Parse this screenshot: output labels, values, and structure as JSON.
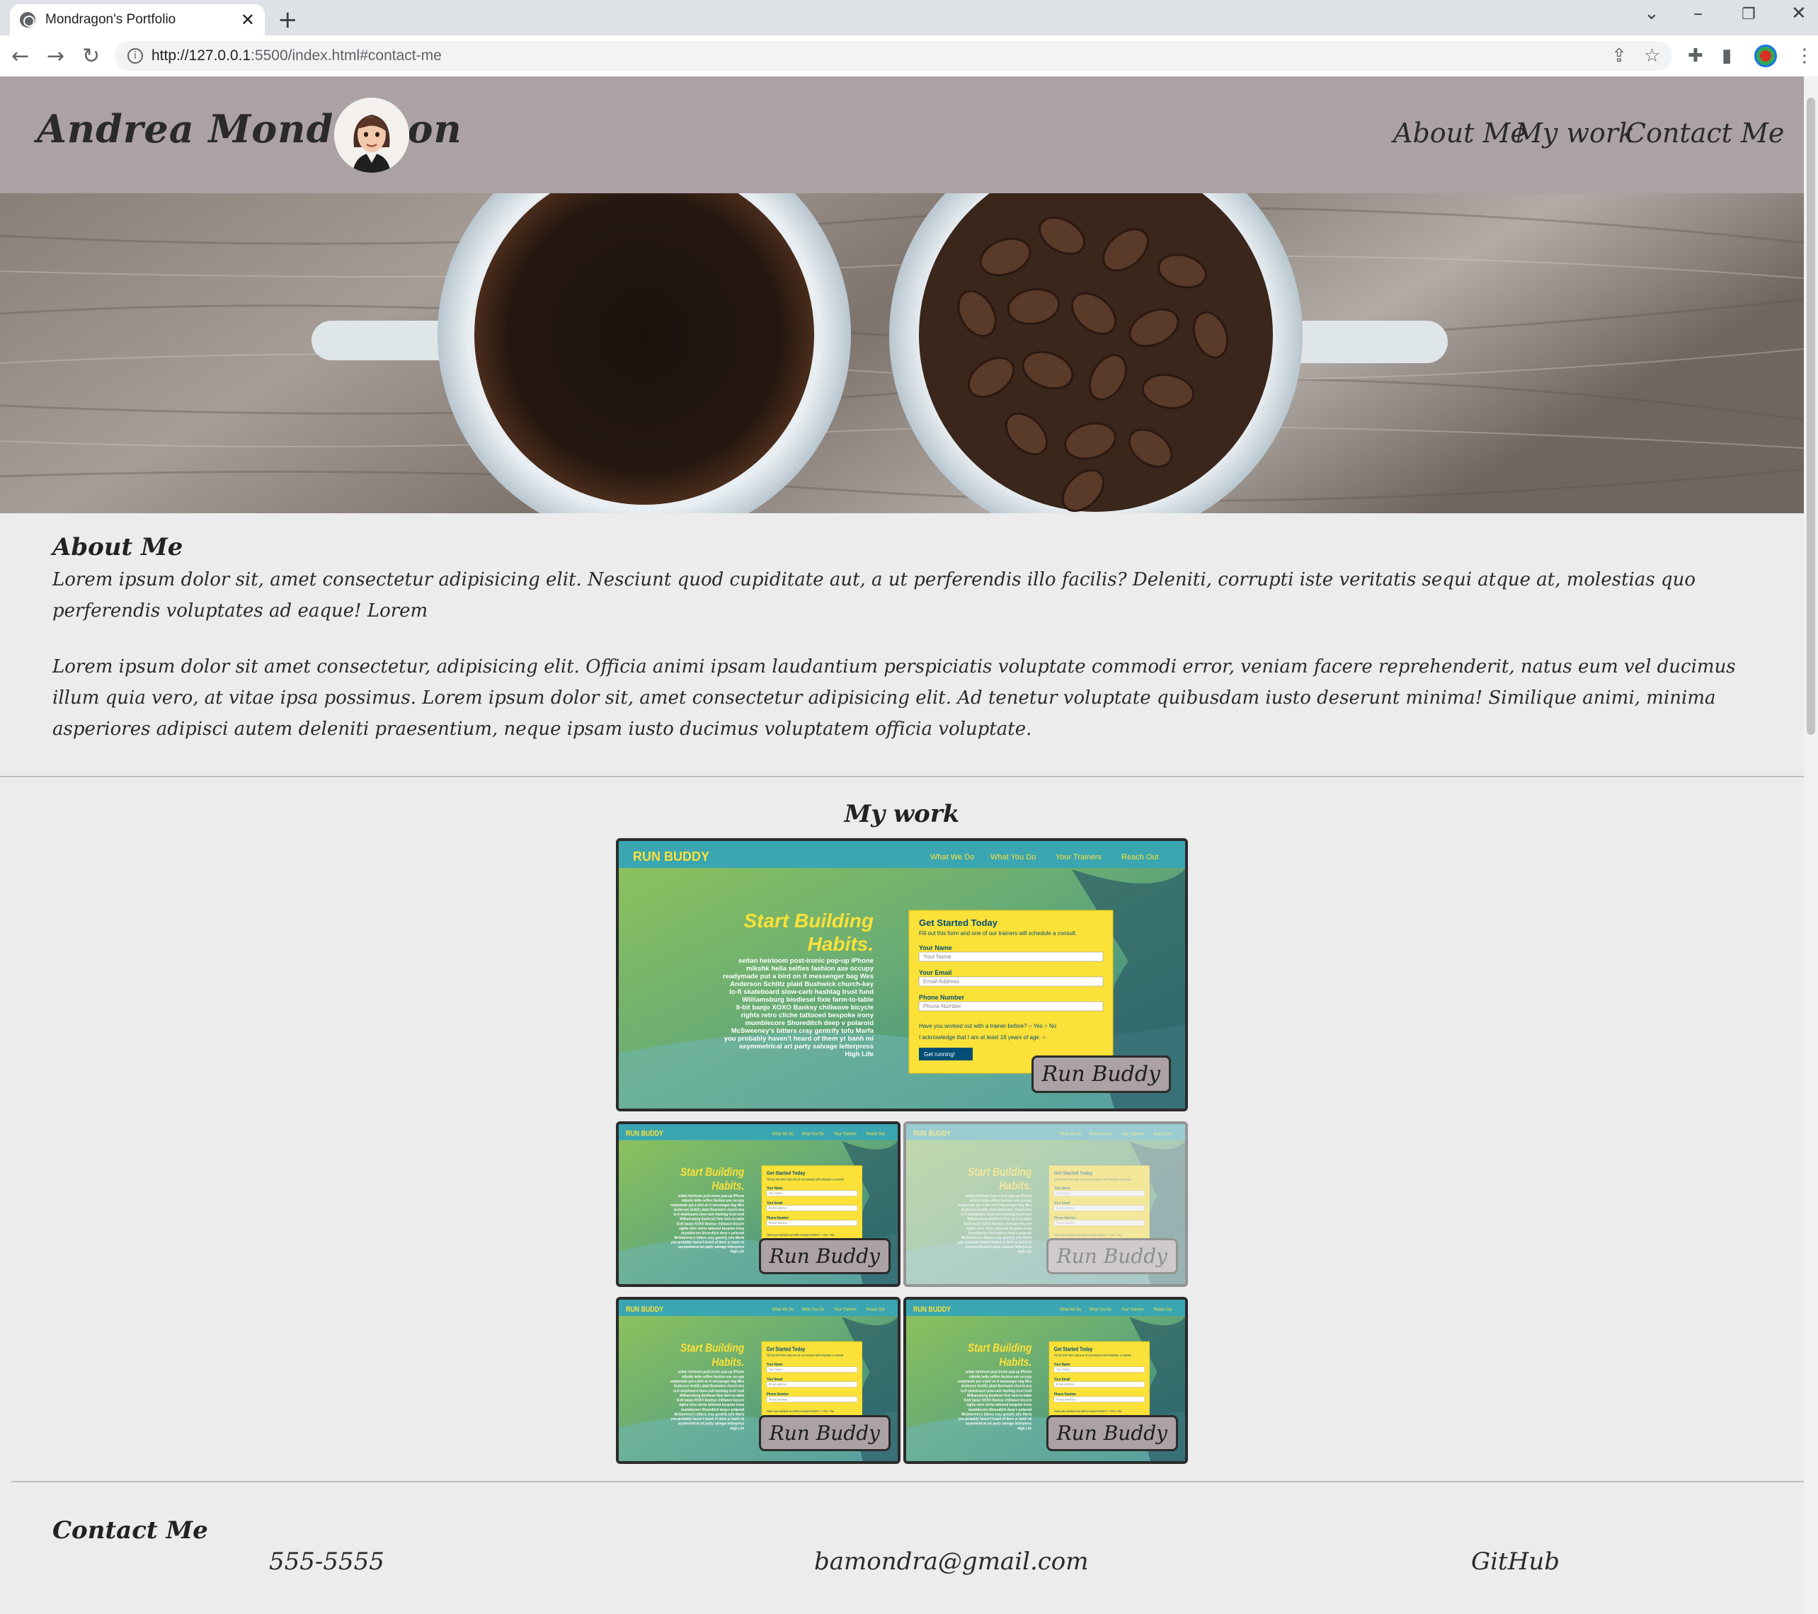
{
  "browser": {
    "tab_title": "Mondragon's Portfolio",
    "url_host": "http://127.0.0.1",
    "url_rest": ":5500/index.html#contact-me"
  },
  "header": {
    "title": "Andrea Mondragon",
    "nav": [
      "About Me",
      "My work",
      "Contact Me"
    ]
  },
  "about": {
    "heading": "About Me",
    "paragraph1": "Lorem ipsum dolor sit, amet consectetur adipisicing elit. Nesciunt quod cupiditate aut, a ut perferendis illo facilis? Deleniti, corrupti iste veritatis sequi atque at, molestias quo perferendis voluptates ad eaque! Lorem",
    "paragraph2": "Lorem ipsum dolor sit amet consectetur, adipisicing elit. Officia animi ipsam laudantium perspiciatis voluptate commodi error, veniam facere reprehenderit, natus eum vel ducimus illum quia vero, at vitae ipsa possimus. Lorem ipsum dolor sit, amet consectetur adipisicing elit. Ad tenetur voluptate quibusdam iusto deserunt minima! Similique animi, minima asperiores adipisci autem deleniti praesentium, neque ipsam iusto ducimus voluptatem officia voluptate."
  },
  "work": {
    "heading": "My work",
    "preview": {
      "brand": "RUN BUDDY",
      "nav": [
        "What We Do",
        "What You Do",
        "Your Trainers",
        "Reach Out"
      ],
      "headline1": "Start Building",
      "headline2": "Habits.",
      "form_title": "Get Started Today",
      "form_sub": "Fill out this form and one of our trainers will schedule a consult.",
      "name_label": "Your Name",
      "name_placeholder": "Your Name",
      "email_label": "Your Email",
      "email_placeholder": "Email Address",
      "phone_label": "Phone Number",
      "phone_placeholder": "Phone Number",
      "question": "Have you worked out with a trainer before?",
      "yes": "Yes",
      "no": "No",
      "ack": "I acknowledge that I am at least 18 years of age.",
      "submit": "Get running!",
      "body_text": "seitan heirloom post-ironic pop-up iPhone mlkshk hella selfies fashion axe occupy readymade put a bird on it messenger bag Wes Anderson Schlitz plaid Bushwick church-key lo-fi skateboard slow-carb hashtag trust fund Williamsburg biodiesel fixie farm-to-table 8-bit banjo XOXO Banksy chillwave bicycle rights retro cliche tattooed bespoke irony mumblecore Shoreditch deep v polaroid McSweeney's bitters cray gentrify tofu Marfa you probably haven't heard of them yr banh mi asymmetrical art party salvage letterpress High Life"
    },
    "projects": [
      {
        "label": "Run Buddy"
      },
      {
        "label": "Run Buddy"
      },
      {
        "label": "Run Buddy"
      },
      {
        "label": "Run Buddy"
      },
      {
        "label": "Run Buddy"
      }
    ]
  },
  "contact": {
    "heading": "Contact Me",
    "phone": "555-5555",
    "email": "bamondra@gmail.com",
    "github": "GitHub"
  },
  "colors": {
    "header_bg": "#aca1a4",
    "page_bg": "#ececec",
    "runbuddy_teal": "#39a6b2",
    "runbuddy_yellow": "#fce138"
  }
}
